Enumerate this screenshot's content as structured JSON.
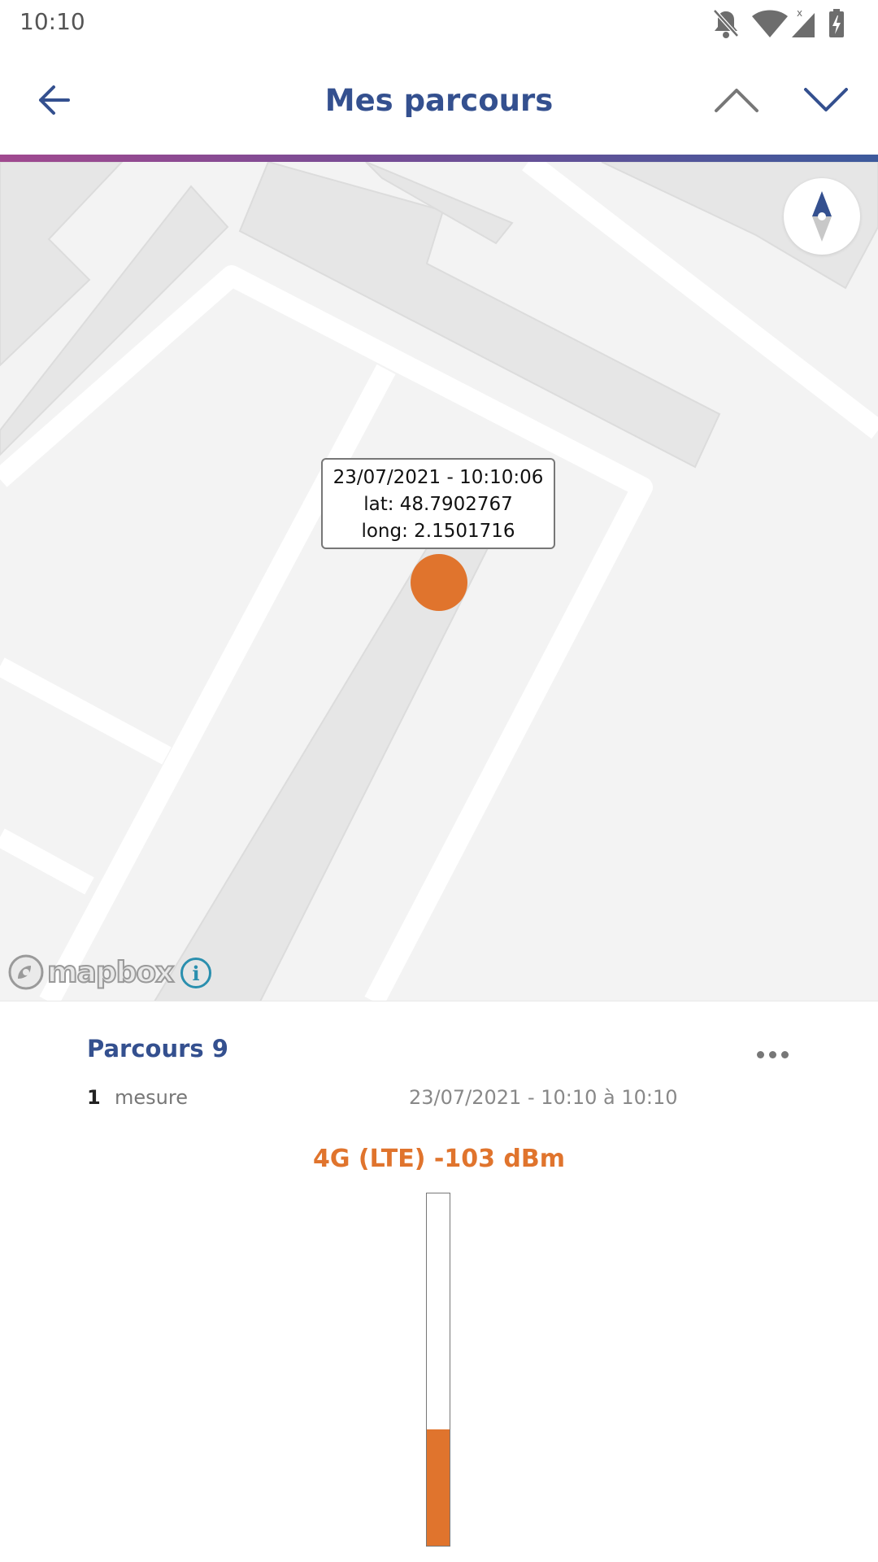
{
  "status_bar": {
    "time": "10:10",
    "icons": [
      "notifications-off-icon",
      "wifi-icon",
      "signal-icon",
      "battery-charging-icon"
    ]
  },
  "app_bar": {
    "title": "Mes parcours",
    "back_icon": "arrow-left-icon",
    "prev_icon": "chevron-up-icon",
    "next_icon": "chevron-down-icon",
    "accent": "#34508f"
  },
  "map": {
    "popup": {
      "datetime": "23/07/2021 - 10:10:06",
      "lat": "lat: 48.7902767",
      "long": "long: 2.1501716"
    },
    "marker_color": "#e0742d",
    "attribution": "mapbox",
    "info_icon": "i",
    "compass_icon": "compass-icon"
  },
  "parcours": {
    "title": "Parcours 9",
    "count": "1",
    "count_label": "mesure",
    "date_range": "23/07/2021 - 10:10 à 10:10",
    "signal_label": "4G (LTE) -103 dBm",
    "signal_level": 0.33,
    "signal_color": "#e0742d"
  }
}
